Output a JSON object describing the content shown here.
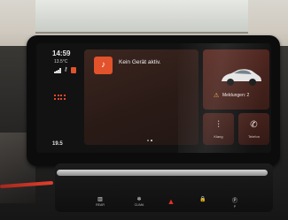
{
  "status_bar": {
    "time": "14:59",
    "temperature": "13.5°C",
    "signal_icon": "signal-bars-icon",
    "connection_icon": "key-icon"
  },
  "media": {
    "message": "Kein Gerät aktiv.",
    "icon": "media-source-icon"
  },
  "vehicle": {
    "warning_icon": "warning-triangle-icon",
    "notifications_label": "Meldungen: 2"
  },
  "tiles": {
    "sound_label": "Klang",
    "phone_label": "Telefon"
  },
  "climate": {
    "temperature": "19.5"
  },
  "console_buttons": [
    {
      "icon": "rear-defrost-icon",
      "label": "REAR"
    },
    {
      "icon": "climate-icon",
      "label": "CLIMA"
    },
    {
      "icon": "hazard-icon",
      "label": ""
    },
    {
      "icon": "lock-icon",
      "label": ""
    },
    {
      "icon": "park-icon",
      "label": "P"
    }
  ],
  "colors": {
    "accent": "#e2522b",
    "tile_bg": "#3a1d18",
    "screen_bg": "#121212"
  }
}
